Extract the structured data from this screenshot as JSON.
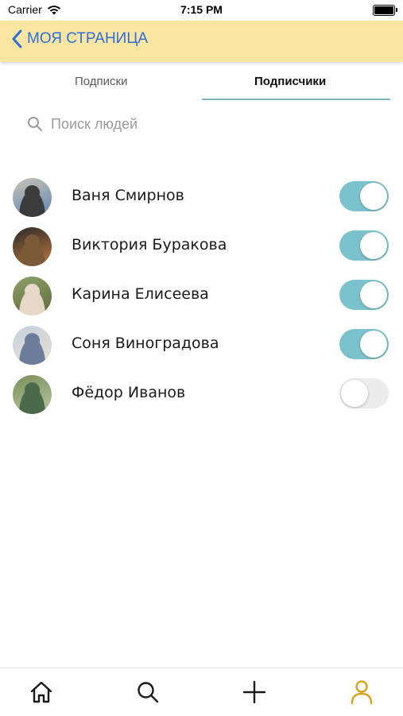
{
  "status_bar": {
    "carrier": "Carrier",
    "time": "7:15 PM"
  },
  "nav": {
    "back_label": "МОЯ СТРАНИЦА"
  },
  "tabs": [
    {
      "label": "Подписки",
      "selected": false
    },
    {
      "label": "Подписчики",
      "selected": true
    }
  ],
  "search": {
    "placeholder": "Поиск людей"
  },
  "people": [
    {
      "name": "Ваня Смирнов",
      "subscribed": true,
      "avatar_colors": [
        "#c9c3b6",
        "#3b3b3b",
        "#5f86b3"
      ]
    },
    {
      "name": "Виктория Буракова",
      "subscribed": true,
      "avatar_colors": [
        "#2a2a2a",
        "#7b5a3a",
        "#c07840"
      ]
    },
    {
      "name": "Карина Елисеева",
      "subscribed": true,
      "avatar_colors": [
        "#8fa06a",
        "#e6d9c8",
        "#5a6b3a"
      ]
    },
    {
      "name": "Соня Виноградова",
      "subscribed": true,
      "avatar_colors": [
        "#c6d1e0",
        "#6b7d9a",
        "#e8e0d0"
      ]
    },
    {
      "name": "Фёдор Иванов",
      "subscribed": false,
      "avatar_colors": [
        "#7a8f5a",
        "#4a6b4a",
        "#b9c7a6"
      ]
    }
  ],
  "tab_bar": {
    "items": [
      {
        "icon": "home-icon",
        "active": false
      },
      {
        "icon": "search-icon",
        "active": false
      },
      {
        "icon": "plus-icon",
        "active": false
      },
      {
        "icon": "profile-icon",
        "active": true
      }
    ]
  },
  "colors": {
    "nav_bg": "#fbe5a2",
    "link_blue": "#2f6fd6",
    "toggle_on": "#7cc2cc",
    "toggle_off": "#ececec",
    "active_tab_icon": "#d9a21e"
  }
}
